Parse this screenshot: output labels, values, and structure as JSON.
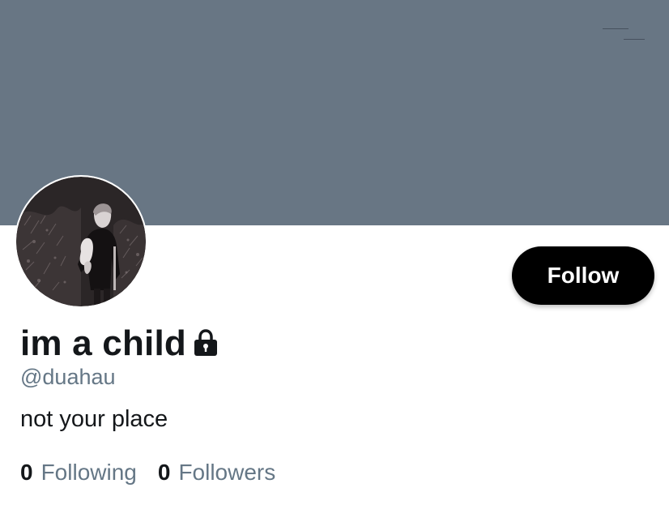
{
  "profile": {
    "display_name": "im a child",
    "protected_icon": "lock-icon",
    "handle": "@duahau",
    "bio": "not your place",
    "avatar_icon": "avatar-photo",
    "banner_color": "#687684"
  },
  "actions": {
    "follow_label": "Follow"
  },
  "stats": {
    "following_count": "0",
    "following_label": "Following",
    "followers_count": "0",
    "followers_label": "Followers"
  }
}
